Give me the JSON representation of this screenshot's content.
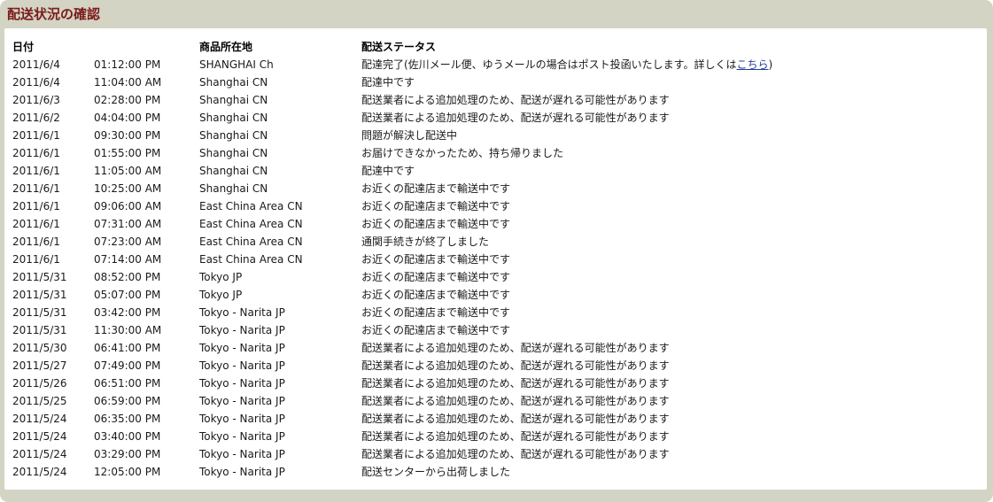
{
  "panel": {
    "title": "配送状況の確認"
  },
  "table": {
    "headers": {
      "date": "日付",
      "location": "商品所在地",
      "status": "配送ステータス"
    },
    "first_row": {
      "date": "2011/6/4",
      "time": "01:12:00 PM",
      "location": "SHANGHAI Ch",
      "status_prefix": "配達完了(佐川メール便、ゆうメールの場合はポスト投函いたします。詳しくは",
      "status_link": "こちら",
      "status_suffix": ")"
    },
    "rows": [
      {
        "date": "2011/6/4",
        "time": "11:04:00 AM",
        "location": "Shanghai CN",
        "status": "配達中です"
      },
      {
        "date": "2011/6/3",
        "time": "02:28:00 PM",
        "location": "Shanghai CN",
        "status": "配送業者による追加処理のため、配送が遅れる可能性があります"
      },
      {
        "date": "2011/6/2",
        "time": "04:04:00 PM",
        "location": "Shanghai CN",
        "status": "配送業者による追加処理のため、配送が遅れる可能性があります"
      },
      {
        "date": "2011/6/1",
        "time": "09:30:00 PM",
        "location": "Shanghai CN",
        "status": "問題が解決し配送中"
      },
      {
        "date": "2011/6/1",
        "time": "01:55:00 PM",
        "location": "Shanghai CN",
        "status": "お届けできなかったため、持ち帰りました"
      },
      {
        "date": "2011/6/1",
        "time": "11:05:00 AM",
        "location": "Shanghai CN",
        "status": "配達中です"
      },
      {
        "date": "2011/6/1",
        "time": "10:25:00 AM",
        "location": "Shanghai CN",
        "status": "お近くの配達店まで輸送中です"
      },
      {
        "date": "2011/6/1",
        "time": "09:06:00 AM",
        "location": "East China Area CN",
        "status": "お近くの配達店まで輸送中です"
      },
      {
        "date": "2011/6/1",
        "time": "07:31:00 AM",
        "location": "East China Area CN",
        "status": "お近くの配達店まで輸送中です"
      },
      {
        "date": "2011/6/1",
        "time": "07:23:00 AM",
        "location": "East China Area CN",
        "status": "通関手続きが終了しました"
      },
      {
        "date": "2011/6/1",
        "time": "07:14:00 AM",
        "location": "East China Area CN",
        "status": "お近くの配達店まで輸送中です"
      },
      {
        "date": "2011/5/31",
        "time": "08:52:00 PM",
        "location": "Tokyo JP",
        "status": "お近くの配達店まで輸送中です"
      },
      {
        "date": "2011/5/31",
        "time": "05:07:00 PM",
        "location": "Tokyo JP",
        "status": "お近くの配達店まで輸送中です"
      },
      {
        "date": "2011/5/31",
        "time": "03:42:00 PM",
        "location": "Tokyo - Narita JP",
        "status": "お近くの配達店まで輸送中です"
      },
      {
        "date": "2011/5/31",
        "time": "11:30:00 AM",
        "location": "Tokyo - Narita JP",
        "status": "お近くの配達店まで輸送中です"
      },
      {
        "date": "2011/5/30",
        "time": "06:41:00 PM",
        "location": "Tokyo - Narita JP",
        "status": "配送業者による追加処理のため、配送が遅れる可能性があります"
      },
      {
        "date": "2011/5/27",
        "time": "07:49:00 PM",
        "location": "Tokyo - Narita JP",
        "status": "配送業者による追加処理のため、配送が遅れる可能性があります"
      },
      {
        "date": "2011/5/26",
        "time": "06:51:00 PM",
        "location": "Tokyo - Narita JP",
        "status": "配送業者による追加処理のため、配送が遅れる可能性があります"
      },
      {
        "date": "2011/5/25",
        "time": "06:59:00 PM",
        "location": "Tokyo - Narita JP",
        "status": "配送業者による追加処理のため、配送が遅れる可能性があります"
      },
      {
        "date": "2011/5/24",
        "time": "06:35:00 PM",
        "location": "Tokyo - Narita JP",
        "status": "配送業者による追加処理のため、配送が遅れる可能性があります"
      },
      {
        "date": "2011/5/24",
        "time": "03:40:00 PM",
        "location": "Tokyo - Narita JP",
        "status": "配送業者による追加処理のため、配送が遅れる可能性があります"
      },
      {
        "date": "2011/5/24",
        "time": "03:29:00 PM",
        "location": "Tokyo - Narita JP",
        "status": "配送業者による追加処理のため、配送が遅れる可能性があります"
      },
      {
        "date": "2011/5/24",
        "time": "12:05:00 PM",
        "location": "Tokyo - Narita JP",
        "status": "配送センターから出荷しました"
      }
    ]
  },
  "colors": {
    "panel_frame": "#d4d4c4",
    "title": "#7a1b1b",
    "link": "#1f3f99"
  }
}
